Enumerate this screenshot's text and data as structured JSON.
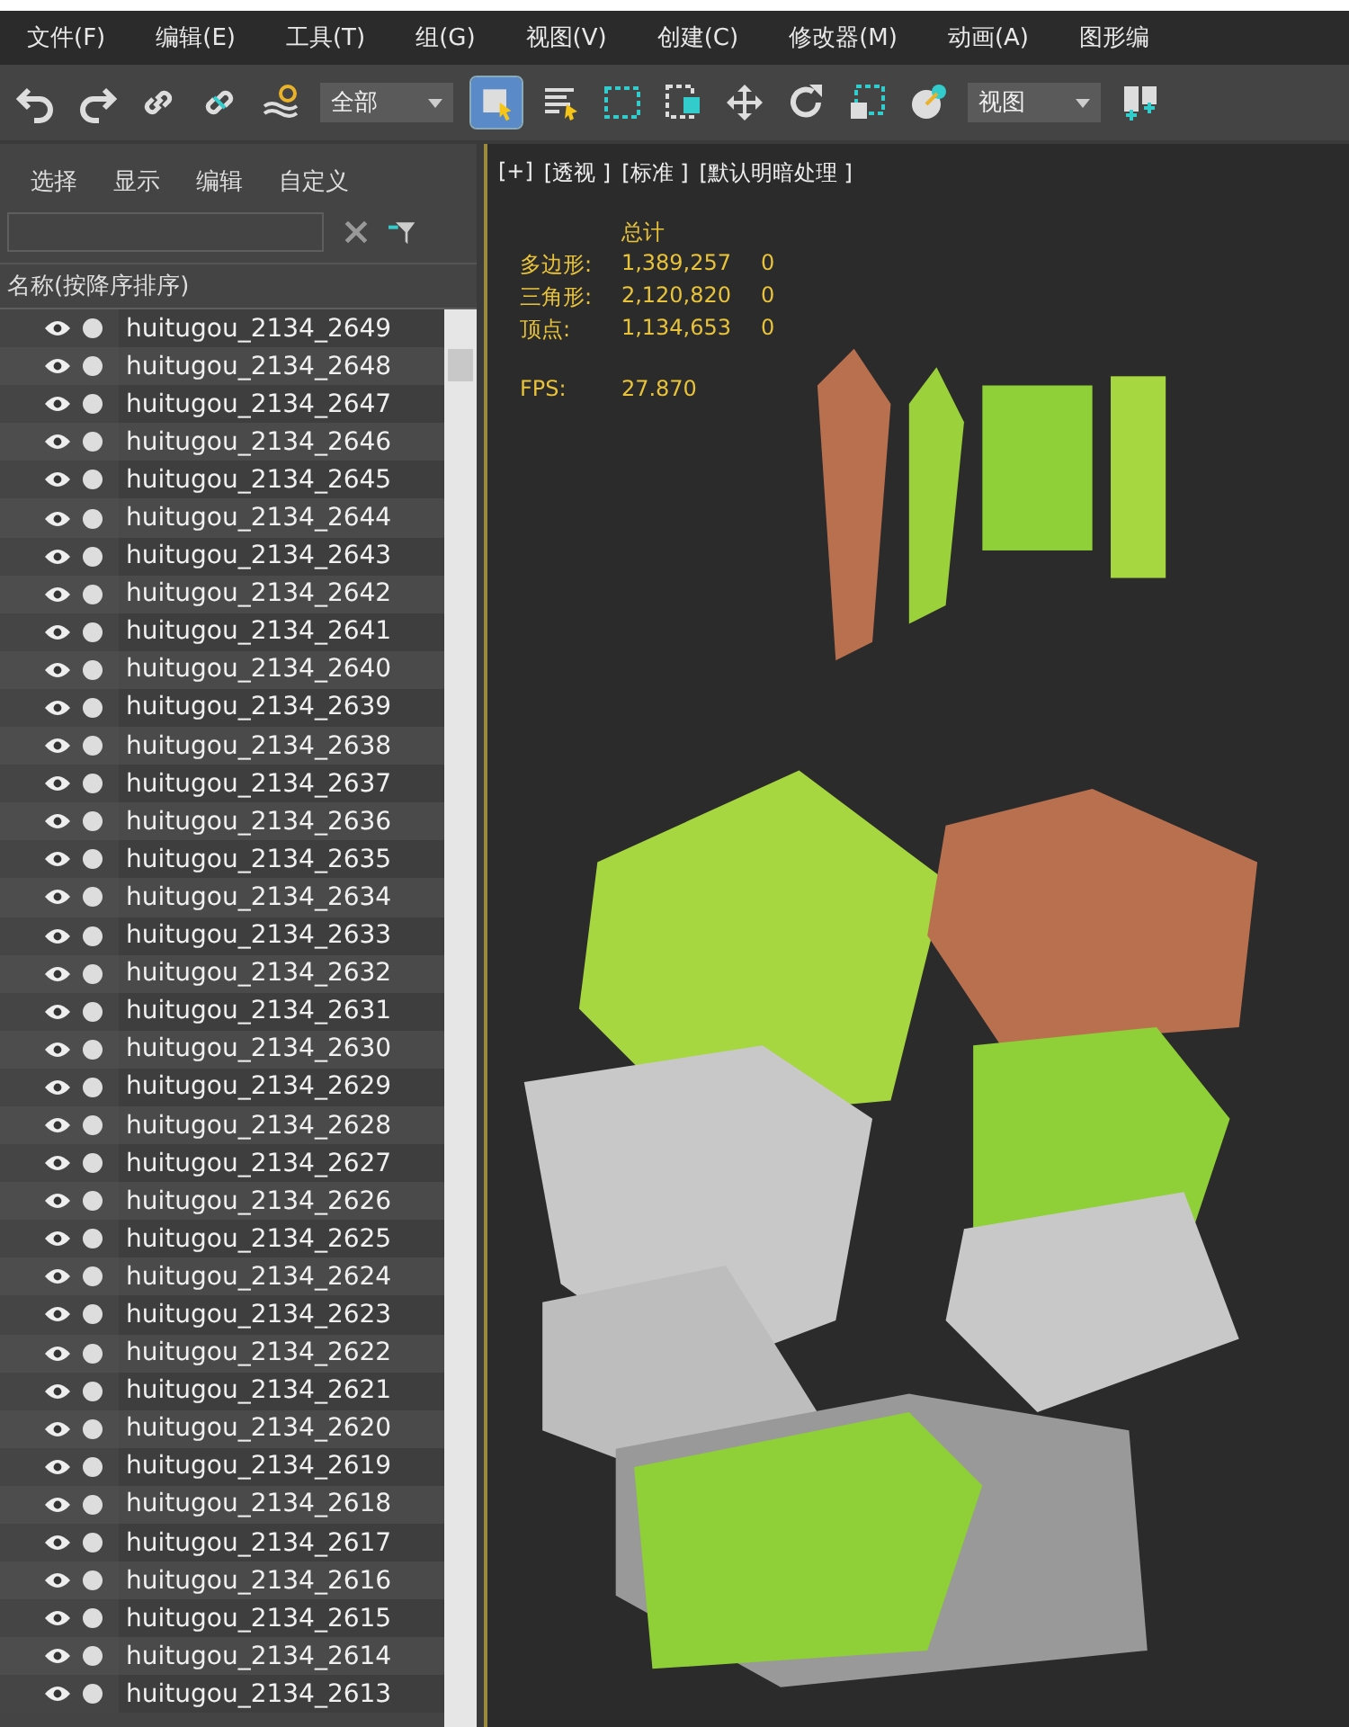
{
  "menu": [
    "文件(F)",
    "编辑(E)",
    "工具(T)",
    "组(G)",
    "视图(V)",
    "创建(C)",
    "修改器(M)",
    "动画(A)",
    "图形编"
  ],
  "toolbar": {
    "selection_filter": "全部",
    "reference_coord": "视图"
  },
  "explorer": {
    "tabs": [
      "选择",
      "显示",
      "编辑",
      "自定义"
    ],
    "column_header": "名称(按降序排序)",
    "rows": [
      "huitugou_2134_2649",
      "huitugou_2134_2648",
      "huitugou_2134_2647",
      "huitugou_2134_2646",
      "huitugou_2134_2645",
      "huitugou_2134_2644",
      "huitugou_2134_2643",
      "huitugou_2134_2642",
      "huitugou_2134_2641",
      "huitugou_2134_2640",
      "huitugou_2134_2639",
      "huitugou_2134_2638",
      "huitugou_2134_2637",
      "huitugou_2134_2636",
      "huitugou_2134_2635",
      "huitugou_2134_2634",
      "huitugou_2134_2633",
      "huitugou_2134_2632",
      "huitugou_2134_2631",
      "huitugou_2134_2630",
      "huitugou_2134_2629",
      "huitugou_2134_2628",
      "huitugou_2134_2627",
      "huitugou_2134_2626",
      "huitugou_2134_2625",
      "huitugou_2134_2624",
      "huitugou_2134_2623",
      "huitugou_2134_2622",
      "huitugou_2134_2621",
      "huitugou_2134_2620",
      "huitugou_2134_2619",
      "huitugou_2134_2618",
      "huitugou_2134_2617",
      "huitugou_2134_2616",
      "huitugou_2134_2615",
      "huitugou_2134_2614",
      "huitugou_2134_2613"
    ]
  },
  "viewport": {
    "labels": [
      "[+]",
      "[透视 ]",
      "[标准 ]",
      "[默认明暗处理 ]"
    ],
    "stats_header": "总计",
    "stats": [
      {
        "label": "多边形:",
        "total": "1,389,257",
        "selected": "0"
      },
      {
        "label": "三角形:",
        "total": "2,120,820",
        "selected": "0"
      },
      {
        "label": "顶点:",
        "total": "1,134,653",
        "selected": "0"
      }
    ],
    "fps_label": "FPS:",
    "fps": "27.870"
  }
}
